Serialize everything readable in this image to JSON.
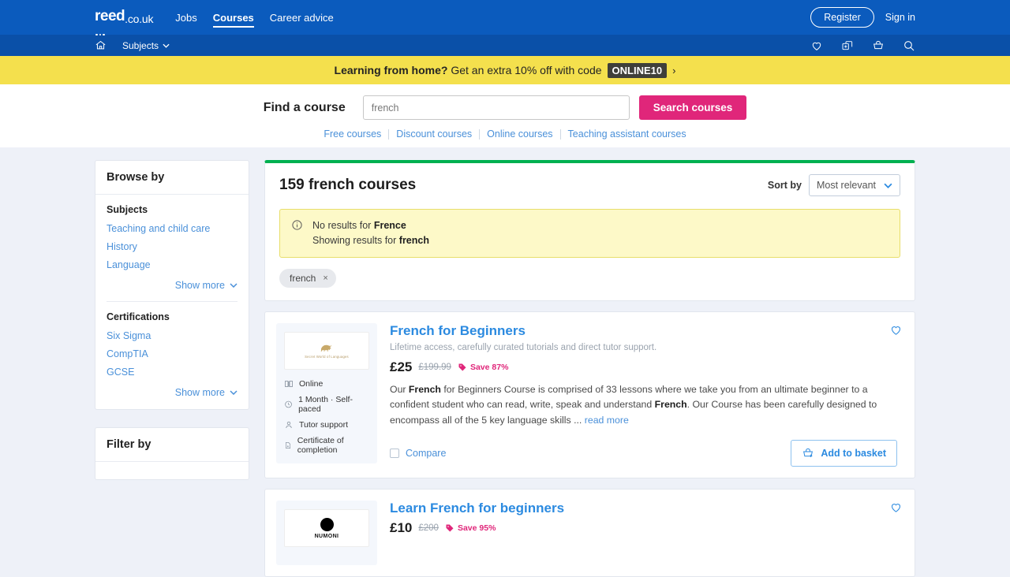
{
  "header": {
    "logo": {
      "brand": "reed",
      "tld": ".co.uk"
    },
    "nav": [
      {
        "label": "Jobs",
        "active": false
      },
      {
        "label": "Courses",
        "active": true
      },
      {
        "label": "Career advice",
        "active": false
      }
    ],
    "register_label": "Register",
    "signin_label": "Sign in",
    "subnav": {
      "home_icon": "home-icon",
      "subjects_label": "Subjects",
      "icons": [
        "heart-icon",
        "compare-icon",
        "basket-icon",
        "search-icon"
      ]
    }
  },
  "promo": {
    "lead": "Learning from home?",
    "rest": "Get an extra 10% off with code",
    "code": "ONLINE10",
    "chevron": "›",
    "bg_color": "#f4e04d"
  },
  "search": {
    "label": "Find a course",
    "value": "french",
    "placeholder": "Search courses",
    "button_label": "Search courses",
    "button_color": "#e0267a",
    "quick_links": [
      "Free courses",
      "Discount courses",
      "Online courses",
      "Teaching assistant courses"
    ]
  },
  "sidebar": {
    "browse": {
      "title": "Browse by",
      "groups": [
        {
          "title": "Subjects",
          "items": [
            "Teaching and child care",
            "History",
            "Language"
          ],
          "show_more": "Show more"
        },
        {
          "title": "Certifications",
          "items": [
            "Six Sigma",
            "CompTIA",
            "GCSE"
          ],
          "show_more": "Show more"
        }
      ]
    },
    "filter": {
      "title": "Filter by"
    }
  },
  "results": {
    "accent_color": "#00b050",
    "title": "159 french courses",
    "sort_label": "Sort by",
    "sort_value": "Most relevant",
    "alert": {
      "icon": "info-icon",
      "line1_prefix": "No results for ",
      "line1_term": "Frence",
      "line2_prefix": "Showing results for ",
      "line2_term": "french"
    },
    "chips": [
      {
        "label": "french",
        "remove": "×"
      }
    ]
  },
  "courses": [
    {
      "title": "French for Beginners",
      "subtitle": "Lifetime access, carefully curated tutorials and direct tutor support.",
      "price": "£25",
      "price_was": "£199.99",
      "save": "Save 87%",
      "logo_caption": "Secret World of Languages",
      "logo_kind": "lion",
      "meta": [
        {
          "icon": "book-icon",
          "label": "Online"
        },
        {
          "icon": "clock-icon",
          "label": "1 Month · Self-paced"
        },
        {
          "icon": "person-icon",
          "label": "Tutor support"
        },
        {
          "icon": "certificate-icon",
          "label": "Certificate of completion"
        }
      ],
      "description_parts": [
        {
          "t": "Our "
        },
        {
          "t": "French",
          "b": true
        },
        {
          "t": " for Beginners Course is comprised of 33 lessons where we take you from an ultimate beginner to a confident student who can read, write, speak and understand "
        },
        {
          "t": "French",
          "b": true
        },
        {
          "t": ". Our Course has been carefully designed to encompass all of the 5 key language skills ... "
        }
      ],
      "read_more": "read more",
      "compare_label": "Compare",
      "basket_label": "Add to basket"
    },
    {
      "title": "Learn French for beginners",
      "price": "£10",
      "price_was": "£200",
      "save": "Save 95%",
      "logo_caption": "NUMONI",
      "logo_kind": "dot"
    }
  ]
}
